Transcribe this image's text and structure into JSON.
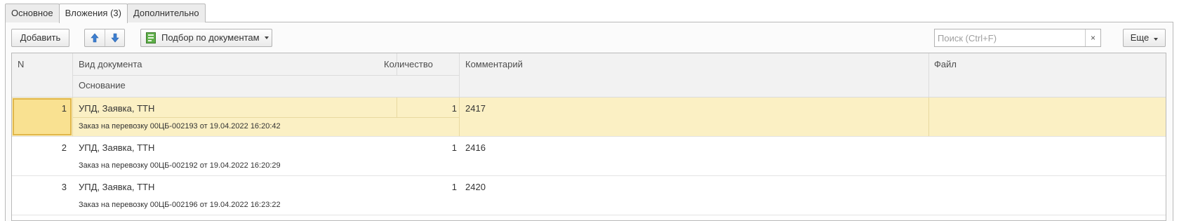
{
  "tabs": [
    {
      "label": "Основное",
      "active": false
    },
    {
      "label": "Вложения (3)",
      "active": true
    },
    {
      "label": "Дополнительно",
      "active": false
    }
  ],
  "toolbar": {
    "add_label": "Добавить",
    "move_up_icon": "arrow-up-icon",
    "move_down_icon": "arrow-down-icon",
    "select_by_docs_label": "Подбор по документам",
    "search_placeholder": "Поиск (Ctrl+F)",
    "search_clear": "×",
    "more_label": "Еще"
  },
  "table": {
    "headers": {
      "n": "N",
      "doc_type": "Вид документа",
      "basis": "Основание",
      "quantity": "Количество",
      "comment": "Комментарий",
      "file": "Файл"
    },
    "rows": [
      {
        "n": "1",
        "doc_type": "УПД, Заявка, ТТН",
        "basis": "Заказ на перевозку 00ЦБ-002193 от 19.04.2022 16:20:42",
        "quantity": "1",
        "comment": "2417",
        "file": ""
      },
      {
        "n": "2",
        "doc_type": "УПД, Заявка, ТТН",
        "basis": "Заказ на перевозку 00ЦБ-002192 от 19.04.2022 16:20:29",
        "quantity": "1",
        "comment": "2416",
        "file": ""
      },
      {
        "n": "3",
        "doc_type": "УПД, Заявка, ТТН",
        "basis": "Заказ на перевозку 00ЦБ-002196 от 19.04.2022 16:23:22",
        "quantity": "1",
        "comment": "2420",
        "file": ""
      }
    ]
  },
  "colors": {
    "selected_row": "#fbf0c4",
    "selected_cell": "#f9e191",
    "arrow_blue": "#3d7fd1"
  }
}
